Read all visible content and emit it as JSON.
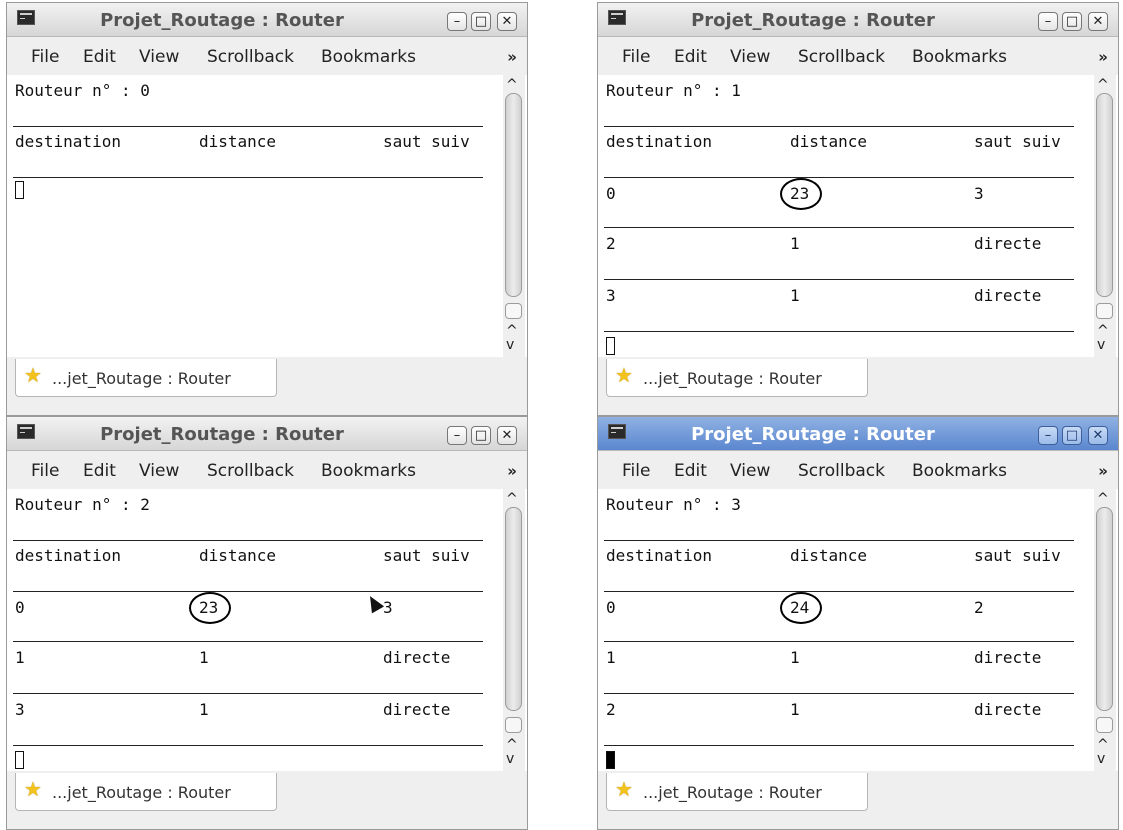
{
  "windows": [
    {
      "title": "Projet_Routage : Router",
      "menu": [
        "File",
        "Edit",
        "View",
        "Scrollback",
        "Bookmarks"
      ],
      "menu_more": "»",
      "router_label": "Routeur n° : 0",
      "headers": [
        "destination",
        "distance",
        "saut suiv"
      ],
      "rows": [],
      "tab_label": "...jet_Routage : Router"
    },
    {
      "title": "Projet_Routage : Router",
      "menu": [
        "File",
        "Edit",
        "View",
        "Scrollback",
        "Bookmarks"
      ],
      "menu_more": "»",
      "router_label": "Routeur n° : 1",
      "headers": [
        "destination",
        "distance",
        "saut suiv"
      ],
      "rows": [
        [
          "0",
          "23",
          "3"
        ],
        [
          "2",
          "1",
          "directe"
        ],
        [
          "3",
          "1",
          "directe"
        ]
      ],
      "tab_label": "...jet_Routage : Router"
    },
    {
      "title": "Projet_Routage : Router",
      "menu": [
        "File",
        "Edit",
        "View",
        "Scrollback",
        "Bookmarks"
      ],
      "menu_more": "»",
      "router_label": "Routeur n° : 2",
      "headers": [
        "destination",
        "distance",
        "saut suiv"
      ],
      "rows": [
        [
          "0",
          "23",
          "3"
        ],
        [
          "1",
          "1",
          "directe"
        ],
        [
          "3",
          "1",
          "directe"
        ]
      ],
      "tab_label": "...jet_Routage : Router"
    },
    {
      "title": "Projet_Routage : Router",
      "menu": [
        "File",
        "Edit",
        "View",
        "Scrollback",
        "Bookmarks"
      ],
      "menu_more": "»",
      "router_label": "Routeur n° : 3",
      "headers": [
        "destination",
        "distance",
        "saut suiv"
      ],
      "rows": [
        [
          "0",
          "24",
          "2"
        ],
        [
          "1",
          "1",
          "directe"
        ],
        [
          "2",
          "1",
          "directe"
        ]
      ],
      "tab_label": "...jet_Routage : Router"
    }
  ]
}
